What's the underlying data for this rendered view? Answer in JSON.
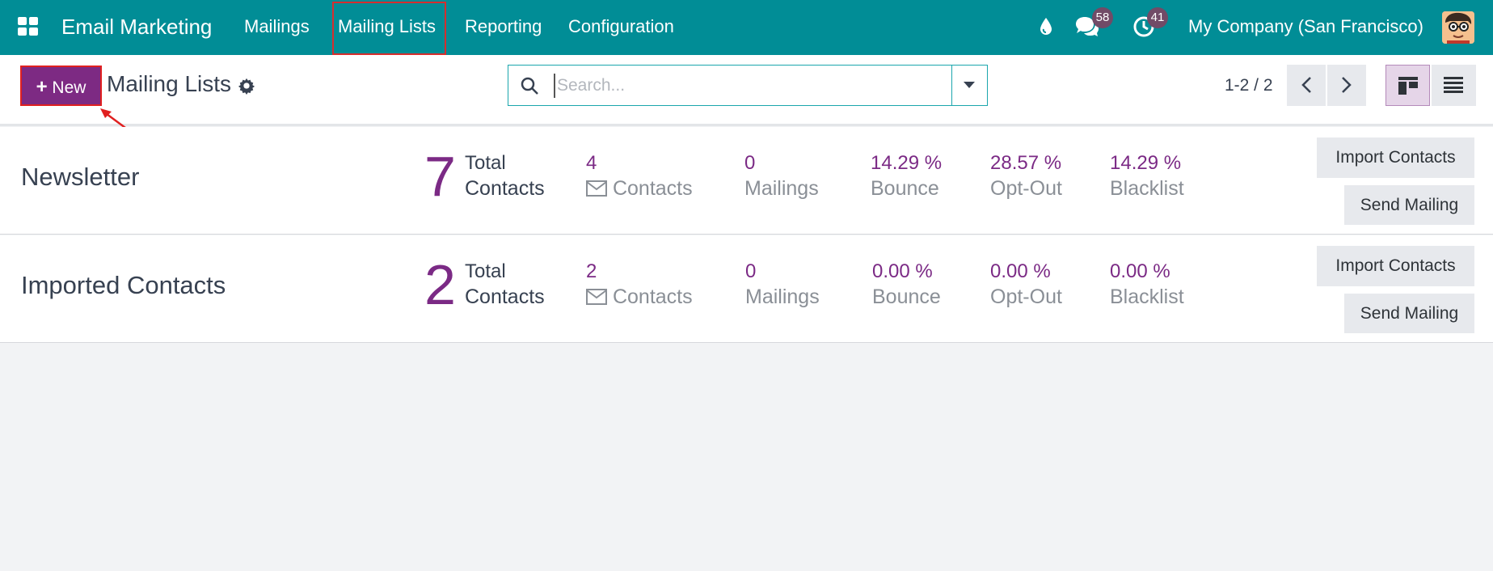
{
  "navbar": {
    "brand": "Email Marketing",
    "menu": [
      "Mailings",
      "Mailing Lists",
      "Reporting",
      "Configuration"
    ],
    "messages_count": "58",
    "activities_count": "41",
    "company": "My Company (San Francisco)",
    "icons": [
      "apps-grid-icon",
      "droplet-icon",
      "chat-icon",
      "clock-icon"
    ]
  },
  "control": {
    "new_label": "New",
    "title": "Mailing Lists",
    "search_placeholder": "Search...",
    "pager": "1-2 / 2"
  },
  "rows": [
    {
      "name": "Newsletter",
      "total": "7",
      "total_label_1": "Total",
      "total_label_2": "Contacts",
      "contacts_value": "4",
      "contacts_label": "Contacts",
      "mailings_value": "0",
      "mailings_label": "Mailings",
      "bounce_value": "14.29 %",
      "bounce_label": "Bounce",
      "optout_value": "28.57 %",
      "optout_label": "Opt-Out",
      "blacklist_value": "14.29 %",
      "blacklist_label": "Blacklist",
      "import_label": "Import Contacts",
      "send_label": "Send Mailing"
    },
    {
      "name": "Imported Contacts",
      "total": "2",
      "total_label_1": "Total",
      "total_label_2": "Contacts",
      "contacts_value": "2",
      "contacts_label": "Contacts",
      "mailings_value": "0",
      "mailings_label": "Mailings",
      "bounce_value": "0.00 %",
      "bounce_label": "Bounce",
      "optout_value": "0.00 %",
      "optout_label": "Opt-Out",
      "blacklist_value": "0.00 %",
      "blacklist_label": "Blacklist",
      "import_label": "Import Contacts",
      "send_label": "Send Mailing"
    }
  ],
  "colors": {
    "navbar": "#018d96",
    "accent": "#7d2a83",
    "stat_value": "#7b2a85",
    "highlight": "#d62e2e"
  }
}
